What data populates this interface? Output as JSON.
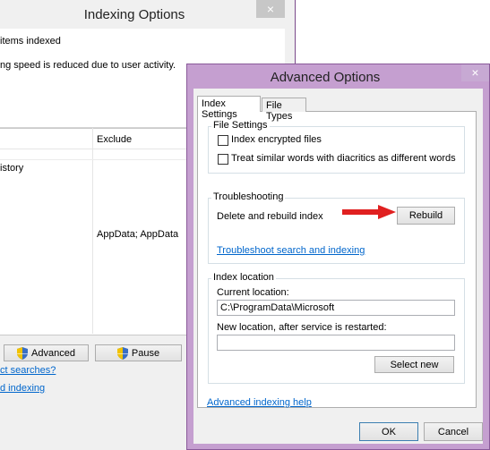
{
  "background_window": {
    "title": "Indexing Options",
    "close_label": "×",
    "items_indexed_text": " items indexed",
    "speed_text": "ng speed is reduced due to user activity.",
    "table": {
      "exclude_header": "Exclude",
      "row_text": "istory",
      "exclude_value": "AppData; AppData"
    },
    "advanced_button": "Advanced",
    "pause_button": "Pause",
    "link_searches": "ct searches?",
    "link_indexing": "d indexing"
  },
  "dialog": {
    "title": "Advanced Options",
    "close_label": "×",
    "tabs": [
      {
        "label": "Index Settings",
        "active": true
      },
      {
        "label": "File Types",
        "active": false
      }
    ],
    "file_settings": {
      "label": "File Settings",
      "options": [
        {
          "label": "Index encrypted files",
          "checked": false
        },
        {
          "label": "Treat similar words with diacritics as different words",
          "checked": false
        }
      ]
    },
    "troubleshooting": {
      "label": "Troubleshooting",
      "delete_rebuild_text": "Delete and rebuild index",
      "rebuild_button": "Rebuild",
      "troubleshoot_link": "Troubleshoot search and indexing"
    },
    "index_location": {
      "label": "Index location",
      "current_label": "Current location:",
      "current_value": "C:\\ProgramData\\Microsoft",
      "new_label": "New location, after service is restarted:",
      "new_value": "",
      "select_new_button": "Select new"
    },
    "help_link": "Advanced indexing help",
    "ok_button": "OK",
    "cancel_button": "Cancel"
  },
  "colors": {
    "dialog_frame": "#c59fd0",
    "link": "#0066cc",
    "arrow": "#e02020"
  }
}
